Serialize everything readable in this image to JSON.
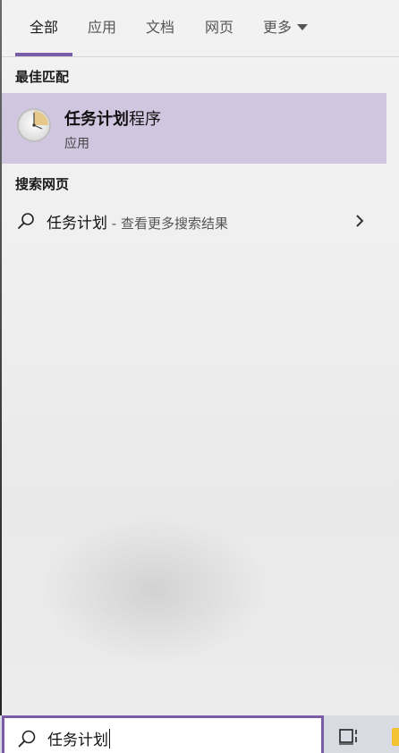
{
  "tabs": [
    {
      "label": "全部",
      "active": true
    },
    {
      "label": "应用",
      "active": false
    },
    {
      "label": "文档",
      "active": false
    },
    {
      "label": "网页",
      "active": false
    },
    {
      "label": "更多",
      "active": false,
      "has_dropdown": true
    }
  ],
  "best_match": {
    "section_title": "最佳匹配",
    "app_name_bold": "任务计划",
    "app_name_rest": "程序",
    "app_type": "应用",
    "icon": "task-scheduler-clock-icon"
  },
  "web_search": {
    "section_title": "搜索网页",
    "query": "任务计划",
    "hint": " - 查看更多搜索结果"
  },
  "search_box": {
    "value": "任务计划"
  },
  "colors": {
    "accent": "#7a5ca8",
    "selection": "#d1c6e0",
    "panel": "#efefef"
  }
}
